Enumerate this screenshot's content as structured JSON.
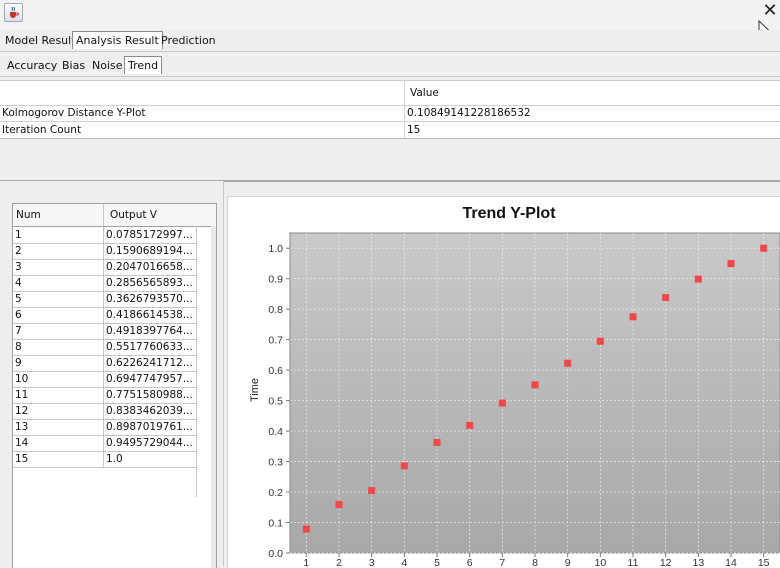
{
  "window": {
    "icon": "java-coffee-icon",
    "close_icon": "close-icon"
  },
  "tabs_primary": [
    {
      "label": "Model Result",
      "selected": false
    },
    {
      "label": "Analysis Result",
      "selected": true
    },
    {
      "label": "Prediction",
      "selected": false
    }
  ],
  "tabs_secondary": [
    {
      "label": "Accuracy",
      "selected": false
    },
    {
      "label": "Bias",
      "selected": false
    },
    {
      "label": "Noise",
      "selected": false
    },
    {
      "label": "Trend",
      "selected": true
    }
  ],
  "summary_table": {
    "headers": [
      "",
      "Value"
    ],
    "rows": [
      {
        "name": "Kolmogorov Distance Y-Plot",
        "value": "0.10849141228186532"
      },
      {
        "name": "Iteration Count",
        "value": "15"
      }
    ]
  },
  "output_table": {
    "headers": [
      "Num",
      "Output V"
    ],
    "rows": [
      {
        "num": "1",
        "value": "0.0785172997..."
      },
      {
        "num": "2",
        "value": "0.1590689194..."
      },
      {
        "num": "3",
        "value": "0.2047016658..."
      },
      {
        "num": "4",
        "value": "0.2856565893..."
      },
      {
        "num": "5",
        "value": "0.3626793570..."
      },
      {
        "num": "6",
        "value": "0.4186614538..."
      },
      {
        "num": "7",
        "value": "0.4918397764..."
      },
      {
        "num": "8",
        "value": "0.5517760633..."
      },
      {
        "num": "9",
        "value": "0.6226241712..."
      },
      {
        "num": "10",
        "value": "0.6947747957..."
      },
      {
        "num": "11",
        "value": "0.7751580988..."
      },
      {
        "num": "12",
        "value": "0.8383462039..."
      },
      {
        "num": "13",
        "value": "0.8987019761..."
      },
      {
        "num": "14",
        "value": "0.9495729044..."
      },
      {
        "num": "15",
        "value": "1.0"
      }
    ]
  },
  "chart_data": {
    "type": "scatter",
    "title": "Trend Y-Plot",
    "xlabel": "",
    "ylabel": "Time",
    "x": [
      1,
      2,
      3,
      4,
      5,
      6,
      7,
      8,
      9,
      10,
      11,
      12,
      13,
      14,
      15
    ],
    "y": [
      0.0785,
      0.1591,
      0.2047,
      0.2857,
      0.3627,
      0.4187,
      0.4918,
      0.5518,
      0.6226,
      0.6948,
      0.7752,
      0.8383,
      0.8987,
      0.9496,
      1.0
    ],
    "xlim": [
      0.5,
      15.5
    ],
    "ylim": [
      0.0,
      1.05
    ],
    "x_ticks": [
      "1",
      "2",
      "3",
      "4",
      "5",
      "6",
      "7",
      "8",
      "9",
      "10",
      "11",
      "12",
      "13",
      "14",
      "15"
    ],
    "y_ticks": [
      "0.0",
      "0.1",
      "0.2",
      "0.3",
      "0.4",
      "0.5",
      "0.6",
      "0.7",
      "0.8",
      "0.9",
      "1.0"
    ],
    "grid": true,
    "marker_color": "#f04848",
    "plot_background": "#bdbdbd"
  }
}
